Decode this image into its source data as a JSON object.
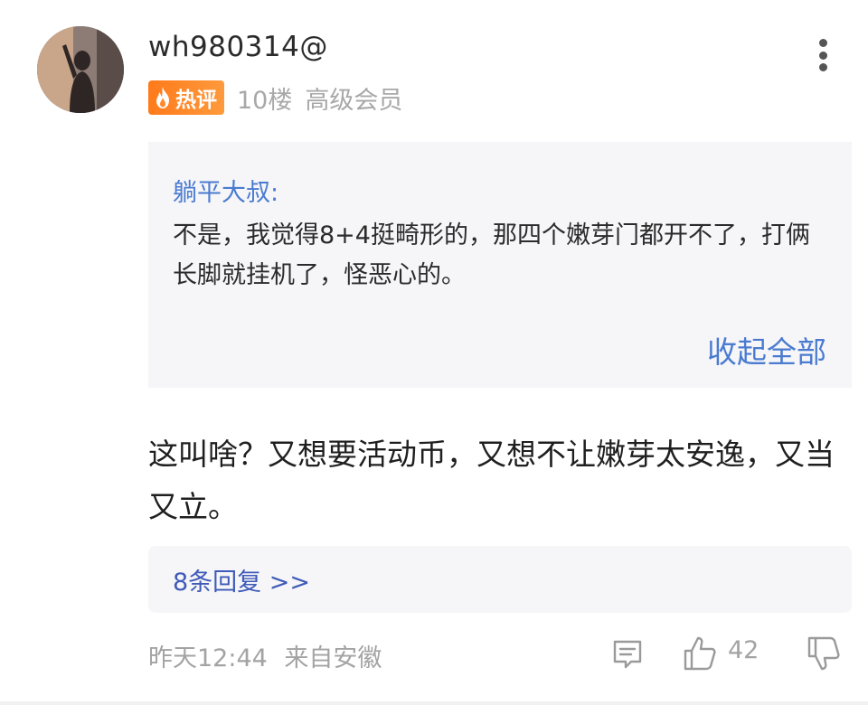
{
  "comment": {
    "username": "wh980314@",
    "badge_label": "热评",
    "floor": "10楼",
    "member_level": "高级会员",
    "quote": {
      "author": "躺平大叔:",
      "text": "不是，我觉得8+4挺畸形的，那四个嫩芽门都开不了，打俩长脚就挂机了，怪恶心的。",
      "collapse_label": "收起全部"
    },
    "body": "这叫啥？又想要活动币，又想不让嫩芽太安逸，又当又立。",
    "replies_label": "8条回复 >>",
    "time": "昨天12:44",
    "location": "来自安徽",
    "like_count": "42"
  },
  "colors": {
    "link_blue": "#4a7bd0",
    "reply_blue": "#3f5ab8",
    "badge_orange": "#ff7a1a",
    "muted_gray": "#a3a3a3",
    "quote_bg": "#f6f6f8"
  },
  "icons": {
    "more": "more-vertical-icon",
    "flame": "flame-icon",
    "comment": "comment-icon",
    "like": "thumbs-up-icon",
    "dislike": "thumbs-down-icon"
  }
}
